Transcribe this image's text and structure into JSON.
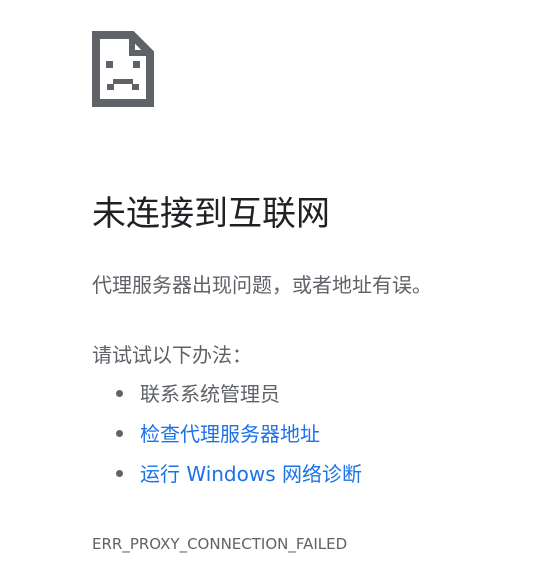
{
  "error_icon": "sad-page-icon",
  "title": "未连接到互联网",
  "message": "代理服务器出现问题，或者地址有误。",
  "suggestions": {
    "heading": "请试试以下办法：",
    "items": [
      {
        "label": "联系系统管理员",
        "is_link": false
      },
      {
        "label": "检查代理服务器地址",
        "is_link": true
      },
      {
        "label": "运行 Windows 网络诊断",
        "is_link": true
      }
    ]
  },
  "error_code": "ERR_PROXY_CONNECTION_FAILED",
  "colors": {
    "title": "#202124",
    "text": "#5f6368",
    "link": "#1a73e8",
    "icon": "#5f6368"
  }
}
